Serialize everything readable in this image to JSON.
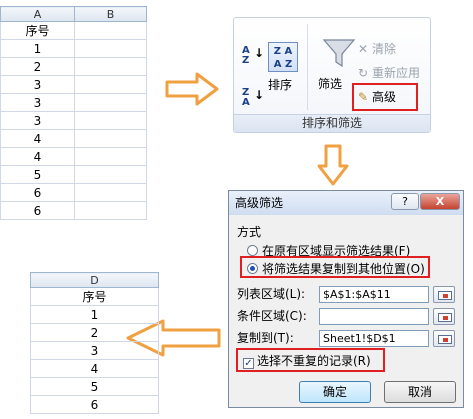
{
  "sheet1": {
    "columns": [
      "A",
      "B"
    ],
    "rows": [
      "序号",
      "1",
      "2",
      "3",
      "3",
      "3",
      "4",
      "4",
      "5",
      "6",
      "6"
    ]
  },
  "ribbon": {
    "sort_az_label": "A Z",
    "sort_za_label": "Z A",
    "sort_big_label": "Z A A Z",
    "sort_label": "排序",
    "filter_label": "筛选",
    "clear_label": "清除",
    "reapply_label": "重新应用",
    "advanced_label": "高级",
    "group_label": "排序和筛选"
  },
  "dialog": {
    "title": "高级筛选",
    "help_label": "?",
    "close_label": "X",
    "section_label": "方式",
    "option1": "在原有区域显示筛选结果(F)",
    "option2": "将筛选结果复制到其他位置(O)",
    "list_range_label": "列表区域(L):",
    "list_range_value": "$A$1:$A$11",
    "criteria_label": "条件区域(C):",
    "criteria_value": "",
    "copy_to_label": "复制到(T):",
    "copy_to_value": "Sheet1!$D$1",
    "unique_label": "选择不重复的记录(R)",
    "ok_label": "确定",
    "cancel_label": "取消"
  },
  "sheet2": {
    "columns": [
      "D"
    ],
    "rows": [
      "序号",
      "1",
      "2",
      "3",
      "4",
      "5",
      "6"
    ]
  },
  "colors": {
    "arrow": "#f0a040",
    "highlight": "#e02020",
    "grid": "#d0d7e5"
  }
}
